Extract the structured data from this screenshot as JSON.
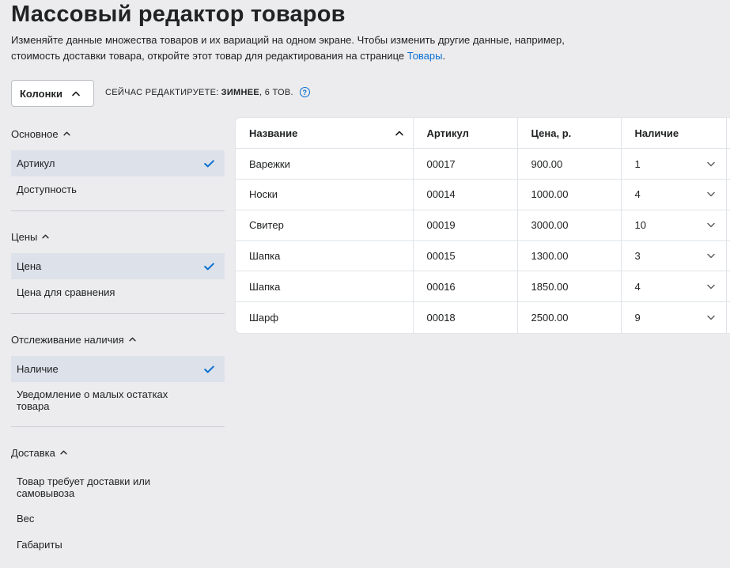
{
  "header": {
    "title": "Массовый редактор товаров",
    "intro_text": "Изменяйте данные множества товаров и их вариаций на одном экране. Чтобы изменить другие данные, например, стоимость доставки товара, откройте этот товар для редактирования на странице ",
    "intro_link": "Товары",
    "intro_end": "."
  },
  "toolbar": {
    "columns_label": "Колонки",
    "editing_label": "СЕЙЧАС РЕДАКТИРУЕТЕ:",
    "editing_value": "ЗИМНЕЕ",
    "editing_count": ", 6 ТОВ.",
    "help_glyph": "?"
  },
  "sidebar": {
    "groups": [
      {
        "title": "Основное",
        "items": [
          {
            "label": "Артикул",
            "selected": true
          },
          {
            "label": "Доступность",
            "selected": false
          }
        ]
      },
      {
        "title": "Цены",
        "items": [
          {
            "label": "Цена",
            "selected": true
          },
          {
            "label": "Цена для сравнения",
            "selected": false
          }
        ]
      },
      {
        "title": "Отслеживание наличия",
        "items": [
          {
            "label": "Наличие",
            "selected": true
          },
          {
            "label": "Уведомление о малых остатках товара",
            "selected": false
          }
        ]
      },
      {
        "title": "Доставка",
        "items": [
          {
            "label": "Товар требует доставки или самовывоза",
            "selected": false
          },
          {
            "label": "Вес",
            "selected": false
          },
          {
            "label": "Габариты",
            "selected": false
          }
        ]
      }
    ]
  },
  "table": {
    "headers": [
      "Название",
      "Артикул",
      "Цена, р.",
      "Наличие"
    ],
    "rows": [
      {
        "name": "Варежки",
        "sku": "00017",
        "price": "900.00",
        "stock": "1"
      },
      {
        "name": "Носки",
        "sku": "00014",
        "price": "1000.00",
        "stock": "4"
      },
      {
        "name": "Свитер",
        "sku": "00019",
        "price": "3000.00",
        "stock": "10"
      },
      {
        "name": "Шапка",
        "sku": "00015",
        "price": "1300.00",
        "stock": "3"
      },
      {
        "name": "Шапка",
        "sku": "00016",
        "price": "1850.00",
        "stock": "4"
      },
      {
        "name": "Шарф",
        "sku": "00018",
        "price": "2500.00",
        "stock": "9"
      }
    ]
  },
  "colors": {
    "accent": "#0a6fd1",
    "selected_bg": "#dde1ea",
    "page_bg": "#ececee"
  },
  "icons": {
    "check": "checkmark-icon",
    "chevron_up": "chevron-up-icon",
    "chevron_down": "chevron-down-icon",
    "help": "help-circle-icon"
  }
}
